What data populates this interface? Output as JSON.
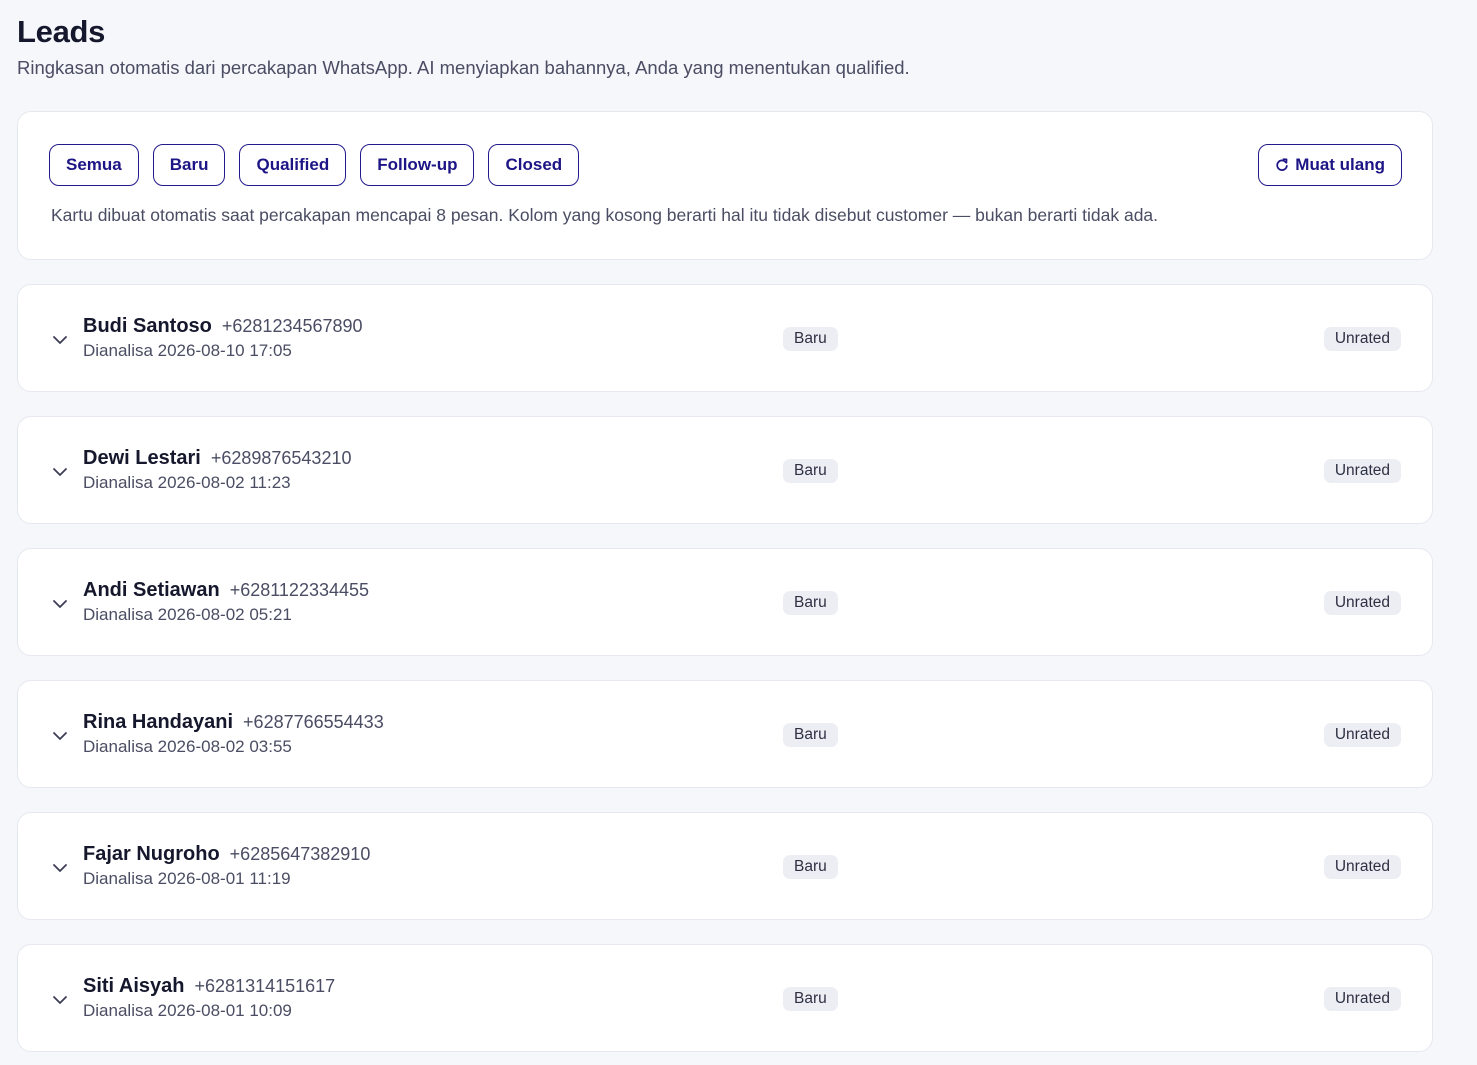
{
  "header": {
    "title": "Leads",
    "subtitle": "Ringkasan otomatis dari percakapan WhatsApp. AI menyiapkan bahannya, Anda yang menentukan qualified."
  },
  "filters": {
    "items": [
      {
        "label": "Semua"
      },
      {
        "label": "Baru"
      },
      {
        "label": "Qualified"
      },
      {
        "label": "Follow-up"
      },
      {
        "label": "Closed"
      }
    ],
    "reload_label": "Muat ulang",
    "note": "Kartu dibuat otomatis saat percakapan mencapai 8 pesan. Kolom yang kosong berarti hal itu tidak disebut customer — bukan berarti tidak ada."
  },
  "leads": [
    {
      "name": "Budi Santoso",
      "phone": "+6281234567890",
      "analyzed": "Dianalisa 2026-08-10 17:05",
      "status": "Baru",
      "rating": "Unrated"
    },
    {
      "name": "Dewi Lestari",
      "phone": "+6289876543210",
      "analyzed": "Dianalisa 2026-08-02 11:23",
      "status": "Baru",
      "rating": "Unrated"
    },
    {
      "name": "Andi Setiawan",
      "phone": "+6281122334455",
      "analyzed": "Dianalisa 2026-08-02 05:21",
      "status": "Baru",
      "rating": "Unrated"
    },
    {
      "name": "Rina Handayani",
      "phone": "+6287766554433",
      "analyzed": "Dianalisa 2026-08-02 03:55",
      "status": "Baru",
      "rating": "Unrated"
    },
    {
      "name": "Fajar Nugroho",
      "phone": "+6285647382910",
      "analyzed": "Dianalisa 2026-08-01 11:19",
      "status": "Baru",
      "rating": "Unrated"
    },
    {
      "name": "Siti Aisyah",
      "phone": "+6281314151617",
      "analyzed": "Dianalisa 2026-08-01 10:09",
      "status": "Baru",
      "rating": "Unrated"
    }
  ],
  "icons": {
    "reload": "refresh-icon",
    "expand": "chevron-down-icon"
  },
  "colors": {
    "accent": "#1d1585",
    "background": "#f6f7fb",
    "badge_bg": "#eceef3"
  }
}
